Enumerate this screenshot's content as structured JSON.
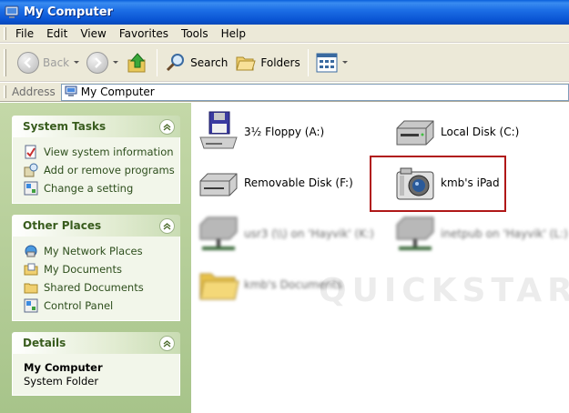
{
  "window": {
    "title": "My Computer"
  },
  "menu": [
    "File",
    "Edit",
    "View",
    "Favorites",
    "Tools",
    "Help"
  ],
  "toolbar": {
    "back_label": "Back",
    "search_label": "Search",
    "folders_label": "Folders"
  },
  "address": {
    "label": "Address",
    "value": "My Computer"
  },
  "system_tasks": {
    "title": "System Tasks",
    "items": [
      "View system information",
      "Add or remove programs",
      "Change a setting"
    ]
  },
  "other_places": {
    "title": "Other Places",
    "items": [
      "My Network Places",
      "My Documents",
      "Shared Documents",
      "Control Panel"
    ]
  },
  "details": {
    "title": "Details",
    "name": "My Computer",
    "type": "System Folder"
  },
  "drives": {
    "floppy": "3½ Floppy (A:)",
    "local": "Local Disk (C:)",
    "removable": "Removable Disk (F:)",
    "ipad": "kmb's iPad",
    "net1": "usr3 (\\\\) on 'Hayvik' (K:)",
    "net2": "inetpub on 'Hayvik' (L:)",
    "docs": "kmb's Documents"
  },
  "watermark": "QUICKSTARTS",
  "colors": {
    "titlebar": "#0a55d4",
    "taskpane": "#a7c48a",
    "highlight": "#b01818"
  }
}
